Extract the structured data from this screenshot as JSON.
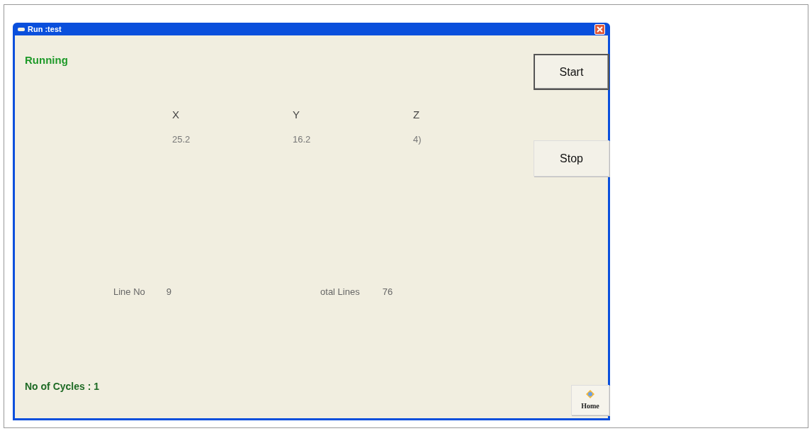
{
  "window": {
    "title": "Run :test"
  },
  "status": "Running",
  "axes": [
    {
      "label": "X",
      "value": "25.2"
    },
    {
      "label": "Y",
      "value": "16.2"
    },
    {
      "label": "Z",
      "value": "4)"
    }
  ],
  "line_no": {
    "label": "Line No",
    "value": "9"
  },
  "total_lines": {
    "label": "otal Lines",
    "value": "76"
  },
  "cycles": "No of Cycles : 1",
  "buttons": [
    {
      "label": "Start",
      "focused": true
    },
    {
      "label": "Stop",
      "focused": false
    }
  ],
  "home_button": {
    "label": "Home"
  }
}
